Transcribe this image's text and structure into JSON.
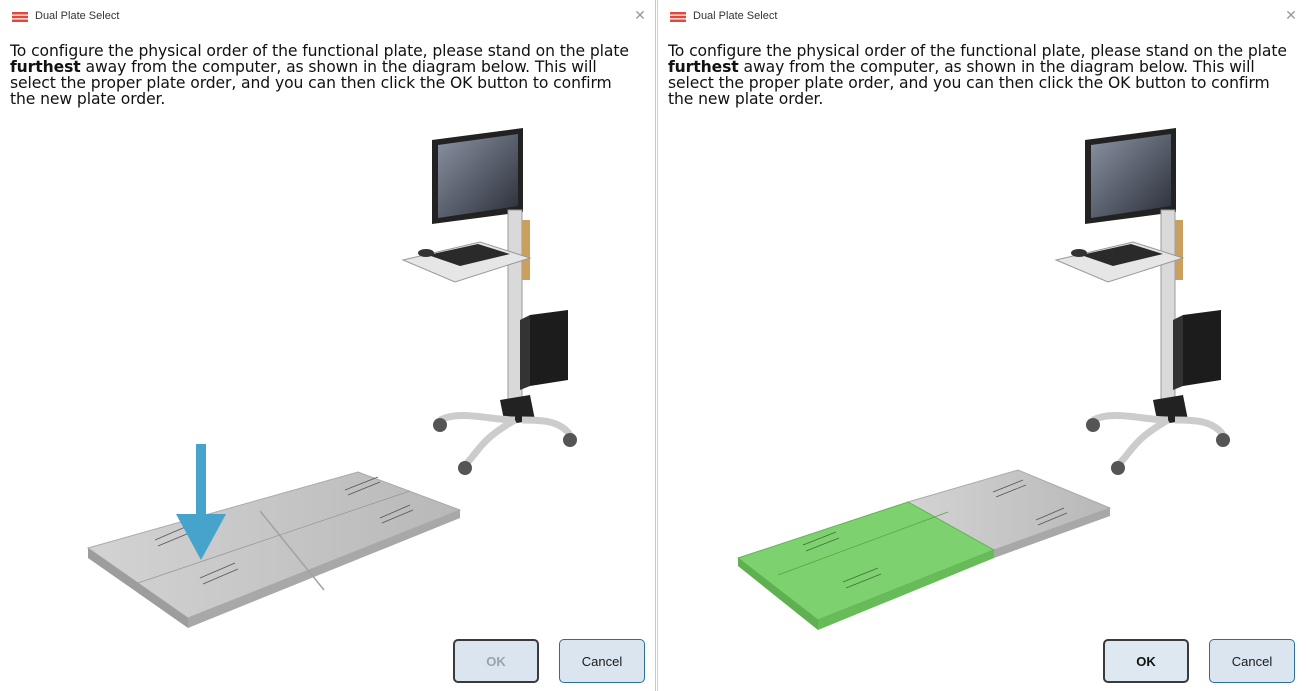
{
  "colors": {
    "title_icon": "#e0483c",
    "arrow": "#45a3cc",
    "plate_gray": "#c4c4c4",
    "plate_green": "#7dd26f",
    "button_bg": "#dbe5ef",
    "button_border_focus": "#3a3a3a",
    "cancel_border": "#2b6f95"
  },
  "dialogs": [
    {
      "title": "Dual Plate Select",
      "close_icon": "✕",
      "instructions": {
        "part1": "To configure the physical order of the functional plate, please stand on the plate ",
        "bold": "furthest",
        "part2": " away from the computer, as shown in the diagram below. This will select the proper plate order, and you can then click the OK button to confirm the new plate order."
      },
      "illustration": {
        "indicator": "arrow-down-icon",
        "highlighted_plate": "none"
      },
      "buttons": {
        "ok": "OK",
        "ok_enabled": false,
        "cancel": "Cancel"
      }
    },
    {
      "title": "Dual Plate Select",
      "close_icon": "✕",
      "instructions": {
        "part1": "To configure the physical order of the functional plate, please stand on the plate ",
        "bold": "furthest",
        "part2": " away from the computer, as shown in the diagram below. This will select the proper plate order, and you can then click the OK button to confirm the new plate order."
      },
      "illustration": {
        "indicator": "none",
        "highlighted_plate": "furthest"
      },
      "buttons": {
        "ok": "OK",
        "ok_enabled": true,
        "cancel": "Cancel"
      }
    }
  ]
}
